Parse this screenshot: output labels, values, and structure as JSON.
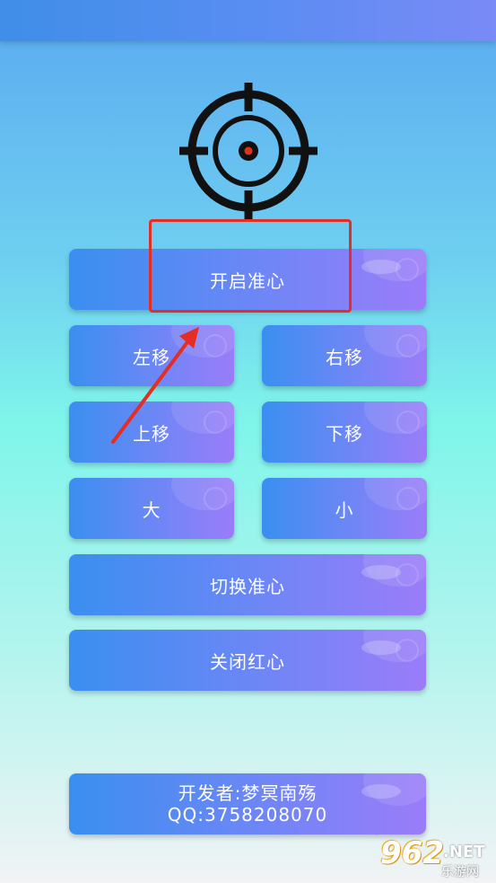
{
  "icons": {
    "crosshair": "crosshair-icon",
    "arrow": "arrow-icon"
  },
  "colors": {
    "crosshair": "#111111",
    "crosshair_center": "#e0301e",
    "annotation": "#e52d24",
    "button_start": "#3a8ff0",
    "button_end": "#9b7cf9"
  },
  "buttons": {
    "open_crosshair": "开启准心",
    "move_left": "左移",
    "move_right": "右移",
    "move_up": "上移",
    "move_down": "下移",
    "bigger": "大",
    "smaller": "小",
    "switch_crosshair": "切换准心",
    "close_red_dot": "关闭红心"
  },
  "developer": {
    "line1": "开发者:梦冥南殇",
    "line2": "QQ:3758208070"
  },
  "watermark": {
    "brand": "962",
    "tld": ".NET",
    "site": "乐游网"
  }
}
